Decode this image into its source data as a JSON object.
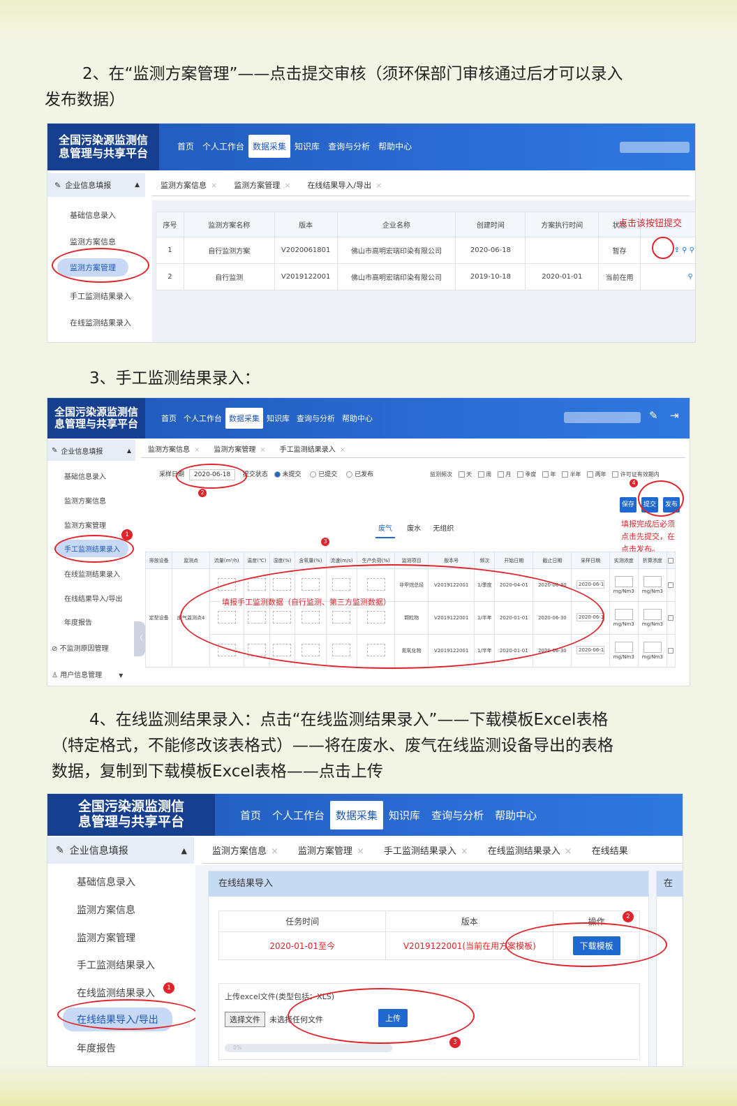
{
  "step2": {
    "text_line1": "2、在“监测方案管理”——点击提交审核（须环保部门审核通过后才可以录入",
    "text_line2": "发布数据）"
  },
  "platform_title_line1": "全国污染源监测信",
  "platform_title_line2": "息管理与共享平台",
  "nav": [
    "首页",
    "个人工作台",
    "数据采集",
    "知识库",
    "查询与分析",
    "帮助中心"
  ],
  "sidebar": {
    "head": "企业信息填报",
    "items": [
      "基础信息录入",
      "监测方案信息",
      "监测方案管理",
      "手工监测结果录入",
      "在线监测结果录入",
      "在线结果导入/导出",
      "年度报告"
    ],
    "extra1": "不监测原因管理",
    "extra2": "用户信息管理"
  },
  "shot1": {
    "tabs": [
      "监测方案信息",
      "监测方案管理",
      "在线结果导入/导出"
    ],
    "columns": [
      "序号",
      "监测方案名称",
      "版本",
      "企业名称",
      "创建时间",
      "方案执行时间",
      "状态"
    ],
    "rows": [
      [
        "1",
        "自行监测方案",
        "V2020061801",
        "佛山市高明宏瑞印染有限公司",
        "2020-06-18",
        "",
        "暂存"
      ],
      [
        "2",
        "自行监测",
        "V2019122001",
        "佛山市高明宏瑞印染有限公司",
        "2019-10-18",
        "2020-01-01",
        "当前在用"
      ]
    ],
    "note": "点击该按钮提交"
  },
  "step3": {
    "text": "3、手工监测结果录入："
  },
  "shot2": {
    "tabs": [
      "监测方案信息",
      "监测方案管理",
      "手工监测结果录入"
    ],
    "date_label": "采样日期",
    "date_value": "2020-06-18",
    "status_label": "提交状态",
    "status_options": [
      "未提交",
      "已提交",
      "已发布"
    ],
    "freq_label": "监测频次",
    "freq_options": [
      "天",
      "周",
      "月",
      "季度",
      "年",
      "半年",
      "两年",
      "许可证有效期内"
    ],
    "buttons": [
      "保存",
      "提交",
      "发布"
    ],
    "subtabs": [
      "废气",
      "废水",
      "无组织"
    ],
    "columns": [
      "排放设备",
      "监测点",
      "流量(m³/h)",
      "温度(℃)",
      "湿度(%)",
      "含氧量(%)",
      "流速(m/s)",
      "生产负荷(%)",
      "监测项目",
      "版本号",
      "频次",
      "开始日期",
      "截止日期",
      "采样日期",
      "实测浓度",
      "折算浓度"
    ],
    "rows": [
      [
        "非甲烷总烃",
        "V2019122001",
        "1/季度",
        "2020-04-01",
        "2020-06-30",
        "2020-06-18"
      ],
      [
        "颗粒物",
        "V2019122001",
        "1/半年",
        "2020-01-01",
        "2020-06-30",
        "2020-06-18"
      ],
      [
        "氮氧化物",
        "V2019122001",
        "1/半年",
        "2020-01-01",
        "2020-06-30",
        "2020-06-18"
      ]
    ],
    "device": "定型设备",
    "point": "废气监测点4",
    "unit": "mg/Nm3",
    "center_note": "填报手工监测数据（自行监测、第三方监测数据）",
    "side_note_line1": "填报完成后必须",
    "side_note_line2": "点击先提交，在",
    "side_note_line3": "点击发布。"
  },
  "step4": {
    "line1": "4、在线监测结果录入：点击“在线监测结果录入”——下载模板Excel表格",
    "line2": "（特定格式，不能修改该表格式）——将在废水、废气在线监测设备导出的表格",
    "line3": "数据，复制到下载模板Excel表格——点击上传"
  },
  "shot3": {
    "tabs": [
      "监测方案信息",
      "监测方案管理",
      "手工监测结果录入",
      "在线监测结果录入",
      "在线结果"
    ],
    "panel_title": "在线结果导入",
    "panel_title_right": "在",
    "columns": [
      "任务时间",
      "版本",
      "操作"
    ],
    "task_time": "2020-01-01至今",
    "version": "V2019122001(当前在用方案模板)",
    "download_btn": "下载模板",
    "upload_label": "上传excel文件(类型包括：XLS)",
    "choose_btn": "选择文件",
    "no_file": "未选择任何文件",
    "upload_btn": "上传",
    "progress": "0%"
  },
  "colors": {
    "header_blue": "#1f57b8",
    "annotation_red": "#e0242a"
  }
}
